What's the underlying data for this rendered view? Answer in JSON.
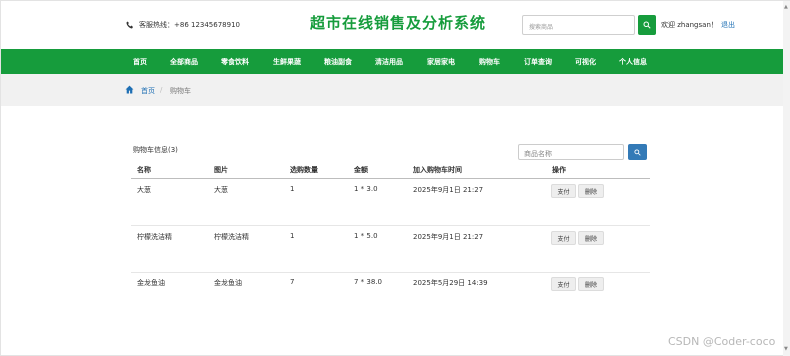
{
  "header": {
    "hotline": "客服热线：+86 12345678910",
    "site_title": "超市在线销售及分析系统",
    "search_placeholder": "搜索商品",
    "welcome": "欢迎 zhangsan！",
    "logout": "退出"
  },
  "nav": {
    "items": [
      "首页",
      "全部商品",
      "零食饮料",
      "生鲜果蔬",
      "粮油副食",
      "清洁用品",
      "家居家电",
      "购物车",
      "订单查询",
      "可视化",
      "个人信息"
    ]
  },
  "breadcrumb": {
    "home": "首页",
    "separator": "/",
    "current": "购物车"
  },
  "cart": {
    "title": "购物车信息(3)",
    "search_placeholder": "商品名称",
    "columns": [
      "名称",
      "图片",
      "选购数量",
      "金额",
      "加入购物车时间",
      "操作"
    ],
    "rows": [
      {
        "name": "大葱",
        "image": "大葱",
        "qty": "1",
        "amount": "1 * 3.0",
        "time": "2025年9月1日 21:27",
        "pay": "支付",
        "delete": "删除"
      },
      {
        "name": "柠檬洗洁精",
        "image": "柠檬洗洁精",
        "qty": "1",
        "amount": "1 * 5.0",
        "time": "2025年9月1日 21:27",
        "pay": "支付",
        "delete": "删除"
      },
      {
        "name": "金龙鱼油",
        "image": "金龙鱼油",
        "qty": "7",
        "amount": "7 * 38.0",
        "time": "2025年5月29日 14:39",
        "pay": "支付",
        "delete": "删除"
      }
    ]
  },
  "scrollbar": {
    "up": "▲",
    "down": "▼"
  },
  "watermark": "CSDN @Coder-coco",
  "colors": {
    "brand_green": "#169c3c",
    "link_blue": "#1e6fb4",
    "search_button_blue": "#337ab7"
  }
}
